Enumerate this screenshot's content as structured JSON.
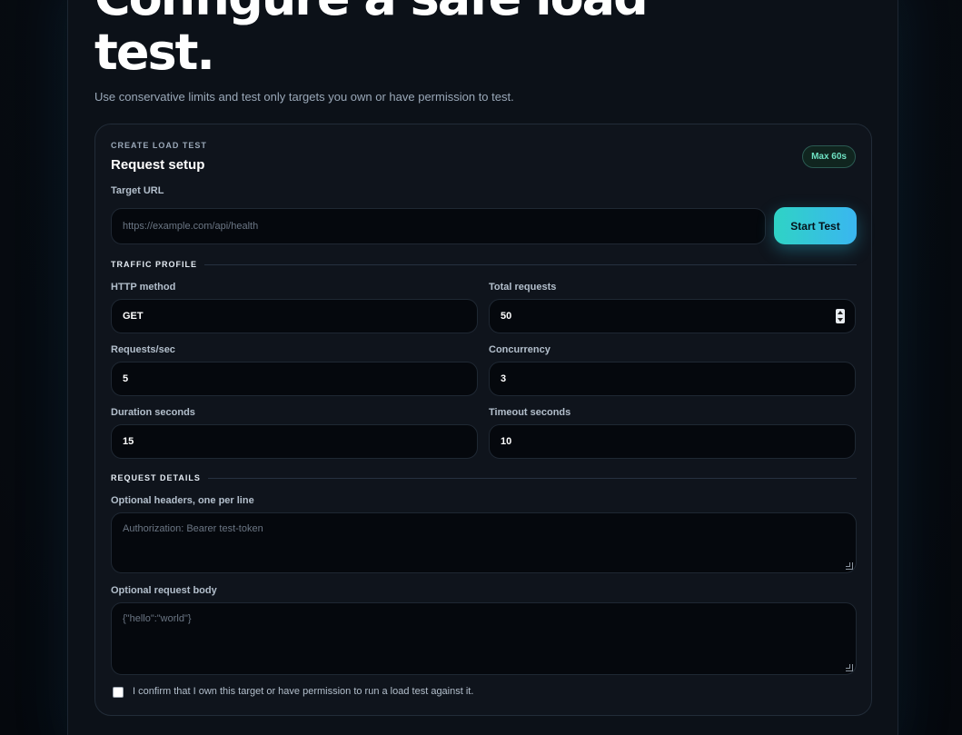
{
  "hero": {
    "title": "Configure a safe load\ntest.",
    "subtitle": "Use conservative limits and test only targets you own or have permission to test."
  },
  "card": {
    "eyebrow": "CREATE LOAD TEST",
    "title": "Request setup",
    "badge": "Max 60s",
    "target_url": {
      "label": "Target URL",
      "placeholder": "https://example.com/api/health",
      "value": ""
    },
    "start_button": "Start Test"
  },
  "traffic_profile": {
    "heading": "TRAFFIC PROFILE",
    "http_method": {
      "label": "HTTP method",
      "value": "GET"
    },
    "total_requests": {
      "label": "Total requests",
      "value": "50"
    },
    "requests_per_sec": {
      "label": "Requests/sec",
      "value": "5"
    },
    "concurrency": {
      "label": "Concurrency",
      "value": "3"
    },
    "duration": {
      "label": "Duration seconds",
      "value": "15"
    },
    "timeout": {
      "label": "Timeout seconds",
      "value": "10"
    }
  },
  "request_details": {
    "heading": "REQUEST DETAILS",
    "headers": {
      "label": "Optional headers, one per line",
      "placeholder": "Authorization: Bearer test-token"
    },
    "body": {
      "label": "Optional request body",
      "placeholder": "{\"hello\":\"world\"}"
    },
    "confirm": {
      "label": "I confirm that I own this target or have permission to run a load test against it.",
      "checked": false
    }
  }
}
